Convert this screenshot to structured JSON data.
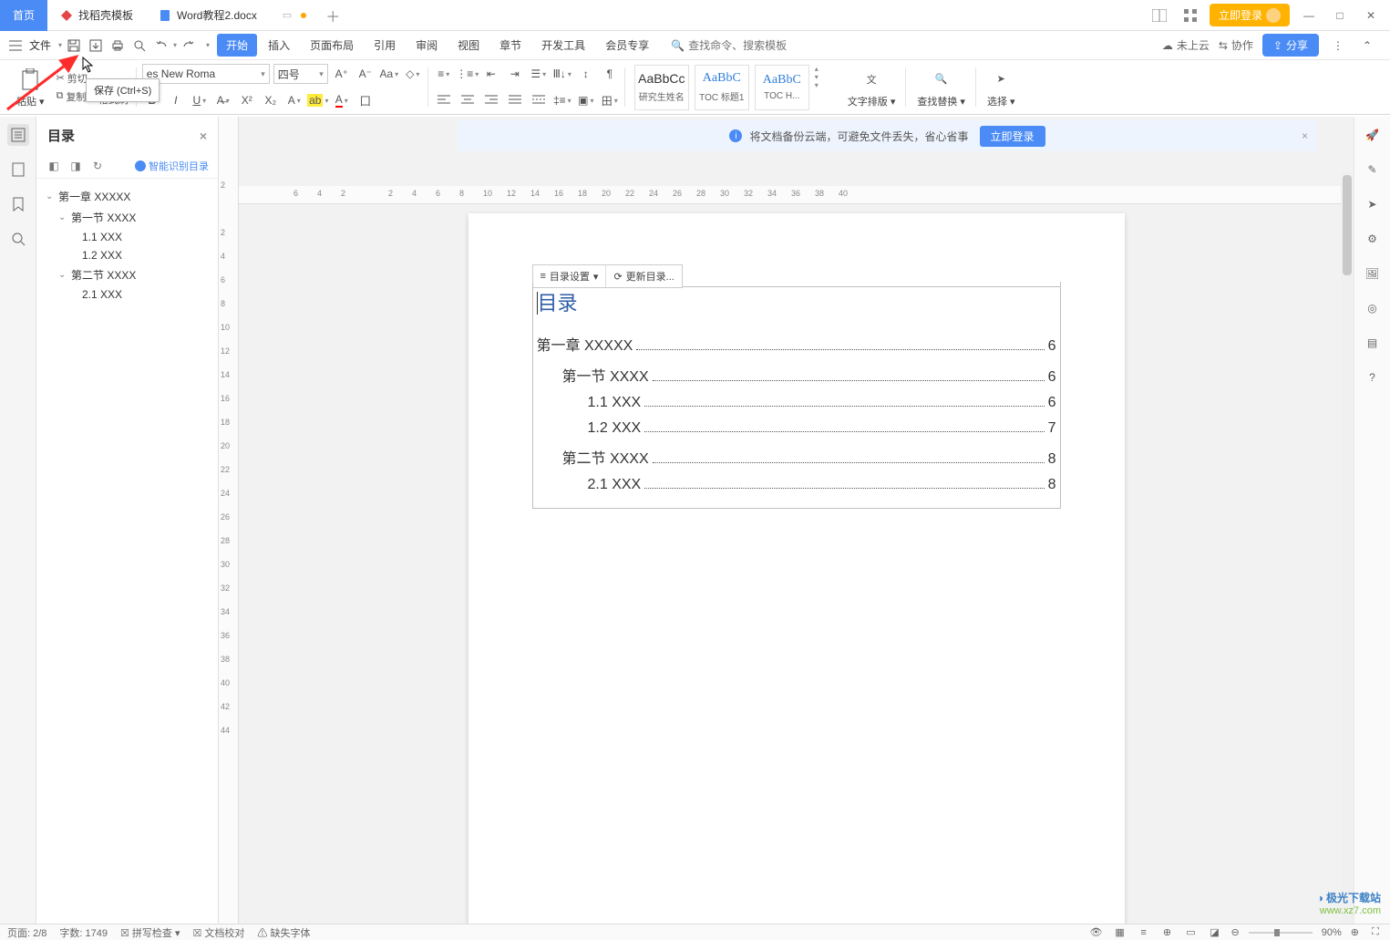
{
  "titlebar": {
    "tabs": [
      {
        "label": "首页"
      },
      {
        "label": "找稻壳模板"
      },
      {
        "label": "Word教程2.docx"
      }
    ],
    "login_label": "立即登录"
  },
  "menubar": {
    "file_label": "文件",
    "items": [
      "开始",
      "插入",
      "页面布局",
      "引用",
      "审阅",
      "视图",
      "章节",
      "开发工具",
      "会员专享"
    ],
    "search_placeholder": "查找命令、搜索模板",
    "right": {
      "cloud": "未上云",
      "collab": "协作",
      "share": "分享"
    }
  },
  "tooltip": {
    "text": "保存 (Ctrl+S)"
  },
  "ribbon": {
    "paste": "粘贴",
    "cut": "剪切",
    "copy": "复制",
    "format_painter": "格式刷",
    "font_name": "es New Roma",
    "font_size": "四号",
    "styles": [
      {
        "preview": "AaBbCc",
        "label": "研究生姓名"
      },
      {
        "preview": "AaBbC",
        "label": "TOC 标题1"
      },
      {
        "preview": "AaBbC",
        "label": "TOC H..."
      }
    ],
    "text_layout": "文字排版",
    "find_replace": "查找替换",
    "select": "选择"
  },
  "banner": {
    "text": "将文档备份云端，可避免文件丢失，省心省事",
    "button": "立即登录"
  },
  "nav": {
    "title": "目录",
    "smart": "智能识别目录",
    "tree": [
      {
        "lvl": 1,
        "text": "第一章  XXXXX"
      },
      {
        "lvl": 2,
        "text": "第一节  XXXX"
      },
      {
        "lvl": 3,
        "text": "1.1 XXX"
      },
      {
        "lvl": 3,
        "text": "1.2 XXX"
      },
      {
        "lvl": 2,
        "text": "第二节  XXXX"
      },
      {
        "lvl": 3,
        "text": "2.1 XXX"
      }
    ]
  },
  "toc_toolbar": {
    "settings": "目录设置",
    "update": "更新目录..."
  },
  "document": {
    "toc_title": "目录",
    "lines": [
      {
        "lvl": 1,
        "label": "第一章  XXXXX",
        "page": "6"
      },
      {
        "lvl": 2,
        "label": "第一节  XXXX",
        "page": "6"
      },
      {
        "lvl": 3,
        "label": "1.1 XXX",
        "page": "6"
      },
      {
        "lvl": 3,
        "label": "1.2 XXX",
        "page": "7"
      },
      {
        "lvl": 2,
        "label": "第二节  XXXX",
        "page": "8"
      },
      {
        "lvl": 3,
        "label": "2.1 XXX",
        "page": "8"
      }
    ]
  },
  "ruler": {
    "h": [
      "6",
      "4",
      "2",
      "",
      "2",
      "4",
      "6",
      "8",
      "10",
      "12",
      "14",
      "16",
      "18",
      "20",
      "22",
      "24",
      "26",
      "28",
      "30",
      "32",
      "34",
      "36",
      "38",
      "40"
    ],
    "v": [
      "2",
      "",
      "2",
      "4",
      "6",
      "8",
      "10",
      "12",
      "14",
      "16",
      "18",
      "20",
      "22",
      "24",
      "26",
      "28",
      "30",
      "32",
      "34",
      "36",
      "38",
      "40",
      "42",
      "44"
    ]
  },
  "statusbar": {
    "page": "页面: 2/8",
    "words": "字数: 1749",
    "spell": "拼写检查",
    "proof": "文档校对",
    "missing_font": "缺失字体",
    "zoom": "90%"
  },
  "watermark": {
    "l1": "极光下载站",
    "l2": "www.xz7.com"
  }
}
